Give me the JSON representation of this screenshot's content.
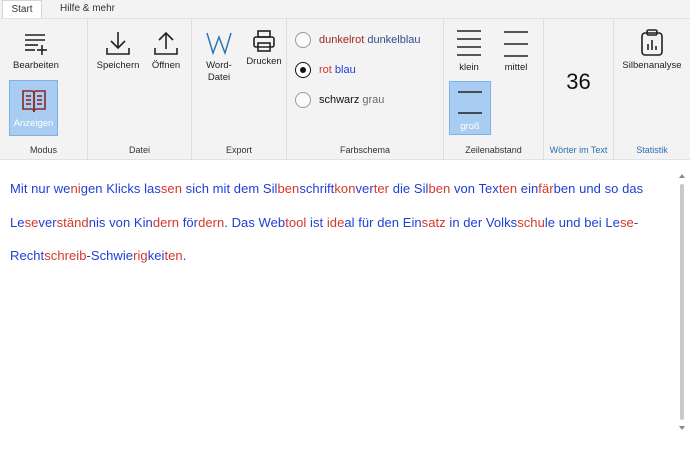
{
  "tabs": [
    {
      "label": "Start"
    },
    {
      "label": "Hilfe & mehr"
    }
  ],
  "groups": {
    "modus": {
      "label": "Modus",
      "edit_label": "Bearbeiten",
      "show_label": "Anzeigen"
    },
    "datei": {
      "label": "Datei",
      "save_label": "Speichern",
      "open_label": "Öffnen"
    },
    "export": {
      "label": "Export",
      "word_line1": "Word-",
      "word_line2": "Datei",
      "print_label": "Drucken"
    },
    "farbschema": {
      "label": "Farbschema",
      "options": [
        {
          "first": "dunkelrot",
          "second": "dunkelblau",
          "first_color": "#a4281f",
          "second_color": "#2e4f8e",
          "checked": false
        },
        {
          "first": "rot",
          "second": "blau",
          "first_color": "#d4372c",
          "second_color": "#1f3fd6",
          "checked": true
        },
        {
          "first": "schwarz",
          "second": "grau",
          "first_color": "#111111",
          "second_color": "#6a6a6a",
          "checked": false
        }
      ]
    },
    "zeilenabstand": {
      "label": "Zeilenabstand",
      "small_label": "klein",
      "medium_label": "mittel",
      "large_label": "groß",
      "selected": "groß"
    },
    "woerter": {
      "label": "Wörter im Text",
      "count": "36"
    },
    "statistik": {
      "label": "Statistik",
      "analysis_label": "Silbenanalyse"
    }
  },
  "text_lines": [
    [
      [
        "Mit nur we",
        "blue"
      ],
      [
        "ni",
        "red"
      ],
      [
        "gen Klicks las",
        "blue"
      ],
      [
        "sen",
        "red"
      ],
      [
        " sich mit dem Sil",
        "blue"
      ],
      [
        "ben",
        "red"
      ],
      [
        "schrift",
        "blue"
      ],
      [
        "kon",
        "red"
      ],
      [
        "ver",
        "blue"
      ],
      [
        "ter",
        "red"
      ],
      [
        " die Sil",
        "blue"
      ],
      [
        "ben",
        "red"
      ],
      [
        " von Tex",
        "blue"
      ],
      [
        "ten",
        "red"
      ],
      [
        " ein",
        "blue"
      ],
      [
        "fär",
        "red"
      ],
      [
        "ben und so das",
        "blue"
      ]
    ],
    [
      [
        "Le",
        "blue"
      ],
      [
        "se",
        "red"
      ],
      [
        "ver",
        "blue"
      ],
      [
        "ständ",
        "red"
      ],
      [
        "nis von Kin",
        "blue"
      ],
      [
        "dern",
        "red"
      ],
      [
        " för",
        "blue"
      ],
      [
        "dern",
        "red"
      ],
      [
        ". Das Web",
        "blue"
      ],
      [
        "tool",
        "red"
      ],
      [
        " ist ",
        "blue"
      ],
      [
        "ide",
        "red"
      ],
      [
        "al für den Ein",
        "blue"
      ],
      [
        "satz",
        "red"
      ],
      [
        " in der Volks",
        "blue"
      ],
      [
        "schu",
        "red"
      ],
      [
        "le und bei Le",
        "blue"
      ],
      [
        "se",
        "red"
      ],
      [
        "-",
        "blue"
      ]
    ],
    [
      [
        "Recht",
        "blue"
      ],
      [
        "schreib",
        "red"
      ],
      [
        "-Schwie",
        "blue"
      ],
      [
        "rig",
        "red"
      ],
      [
        "kei",
        "blue"
      ],
      [
        "ten",
        "red"
      ],
      [
        ".",
        "blue"
      ]
    ]
  ],
  "colors": {
    "accent_selected": "#a9cdf2",
    "syllable_a": "#1f3fd6",
    "syllable_b": "#d4372c"
  },
  "icons": {
    "edit": "list-plus-icon",
    "show": "open-book-icon",
    "save": "download-icon",
    "open": "upload-icon",
    "word": "word-w-icon",
    "print": "printer-icon",
    "small": "lines-tight-icon",
    "medium": "lines-medium-icon",
    "large": "lines-wide-icon",
    "analysis": "clipboard-chart-icon"
  }
}
